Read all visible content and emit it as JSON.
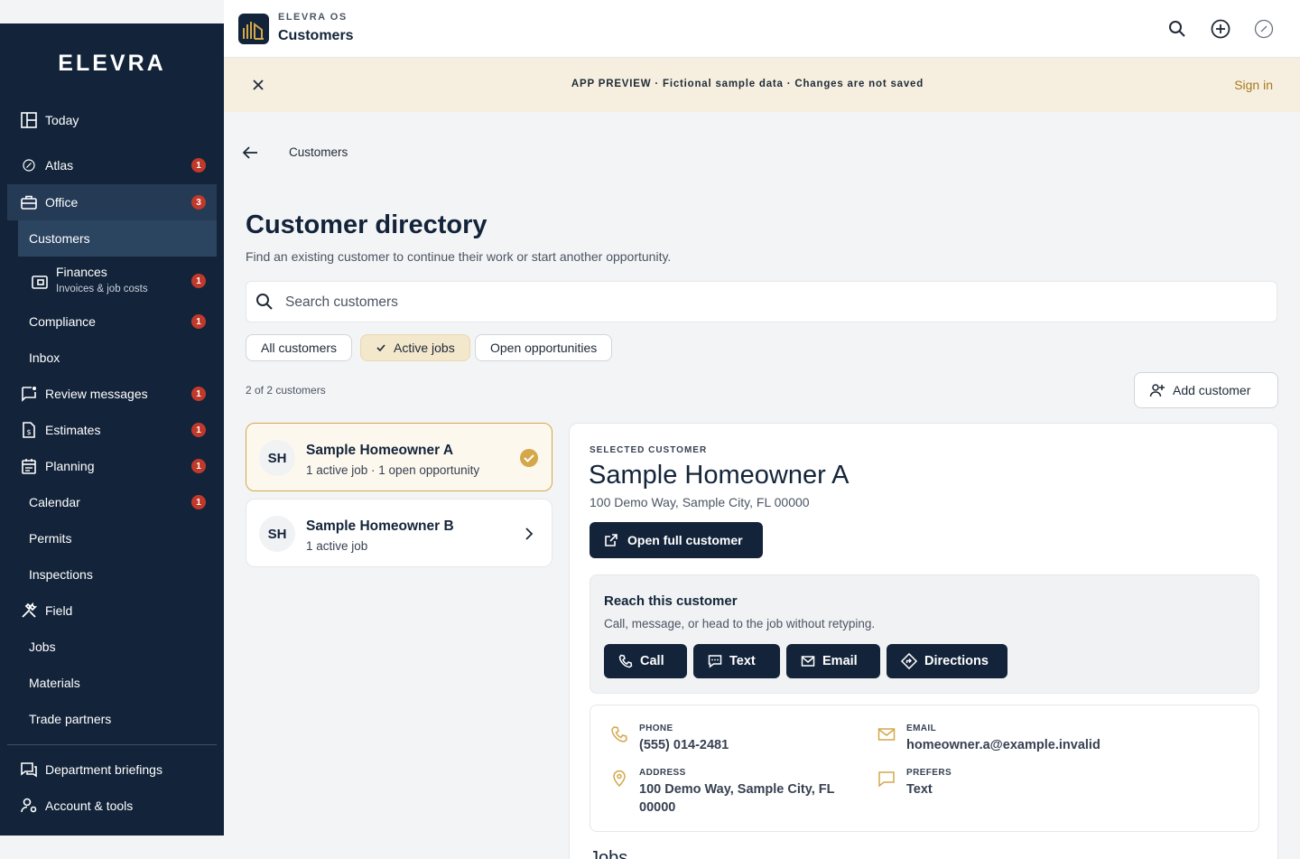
{
  "sidebar": {
    "brand": "ELEVRA",
    "items": {
      "today": {
        "label": "Today"
      },
      "atlas": {
        "label": "Atlas",
        "badge": "1"
      },
      "office": {
        "label": "Office",
        "badge": "3"
      },
      "customers": {
        "label": "Customers"
      },
      "finances": {
        "label": "Finances",
        "sublabel": "Invoices & job costs",
        "badge": "1"
      },
      "compliance": {
        "label": "Compliance",
        "badge": "1"
      },
      "inbox": {
        "label": "Inbox"
      },
      "review_messages": {
        "label": "Review messages",
        "badge": "1"
      },
      "estimates": {
        "label": "Estimates",
        "badge": "1"
      },
      "planning": {
        "label": "Planning",
        "badge": "1"
      },
      "calendar": {
        "label": "Calendar",
        "badge": "1"
      },
      "permits": {
        "label": "Permits"
      },
      "inspections": {
        "label": "Inspections"
      },
      "field": {
        "label": "Field"
      },
      "jobs": {
        "label": "Jobs"
      },
      "materials": {
        "label": "Materials"
      },
      "trade_partners": {
        "label": "Trade partners"
      },
      "department_briefings": {
        "label": "Department briefings"
      },
      "account_tools": {
        "label": "Account & tools"
      }
    }
  },
  "topbar": {
    "app_name": "ELEVRA OS",
    "page_title": "Customers"
  },
  "banner": {
    "message": "APP PREVIEW · Fictional sample data · Changes are not saved",
    "sign_in": "Sign in"
  },
  "page": {
    "breadcrumb": "Customers",
    "title": "Customer directory",
    "subtitle": "Find an existing customer to continue their work or start another opportunity.",
    "search_placeholder": "Search customers",
    "filters": {
      "all": "All customers",
      "active": "Active jobs",
      "open": "Open opportunities"
    },
    "count": "2 of 2 customers",
    "add_customer": "Add customer"
  },
  "customers": [
    {
      "initials": "SH",
      "name": "Sample Homeowner A",
      "meta": "1 active job · 1 open opportunity"
    },
    {
      "initials": "SH",
      "name": "Sample Homeowner B",
      "meta": "1 active job"
    }
  ],
  "detail": {
    "eyebrow": "SELECTED CUSTOMER",
    "name": "Sample Homeowner A",
    "address": "100 Demo Way, Sample City, FL 00000",
    "open_full": "Open full customer",
    "reach": {
      "title": "Reach this customer",
      "subtitle": "Call, message, or head to the job without retyping.",
      "call": "Call",
      "text": "Text",
      "email": "Email",
      "directions": "Directions"
    },
    "info": {
      "phone_label": "PHONE",
      "phone": "(555) 014-2481",
      "email_label": "EMAIL",
      "email": "homeowner.a@example.invalid",
      "address_label": "ADDRESS",
      "address_line1": "100 Demo Way, Sample City, FL",
      "address_line2": "00000",
      "prefers_label": "PREFERS",
      "prefers": "Text"
    },
    "jobs_heading": "Jobs"
  },
  "colors": {
    "sidebar": "#13243a",
    "accent": "#d4a74a",
    "badge": "#c0392b",
    "banner": "#f6efe0"
  }
}
